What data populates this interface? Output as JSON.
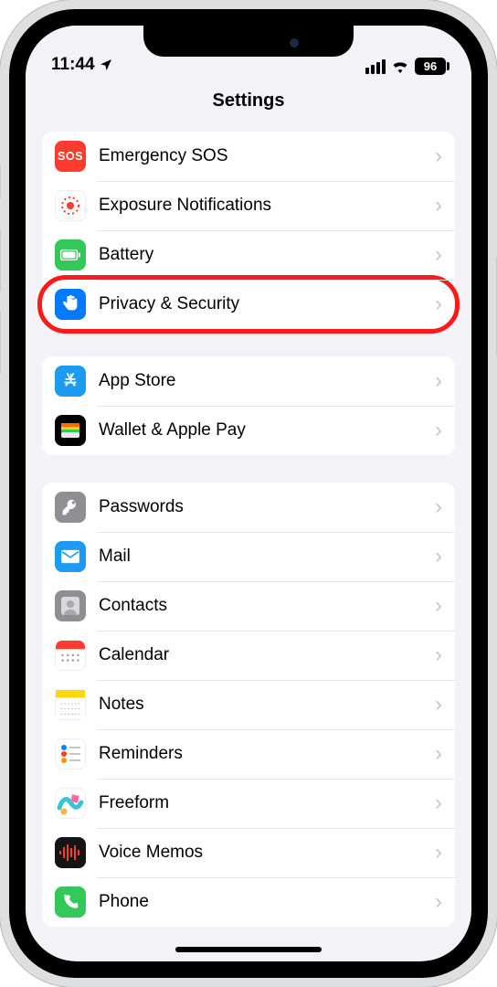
{
  "status": {
    "time": "11:44",
    "battery": "96"
  },
  "header": {
    "title": "Settings"
  },
  "groups": [
    {
      "rows": [
        {
          "id": "emergency-sos",
          "label": "Emergency SOS"
        },
        {
          "id": "exposure",
          "label": "Exposure Notifications"
        },
        {
          "id": "battery",
          "label": "Battery"
        },
        {
          "id": "privacy",
          "label": "Privacy & Security",
          "highlight": true
        }
      ]
    },
    {
      "rows": [
        {
          "id": "app-store",
          "label": "App Store"
        },
        {
          "id": "wallet",
          "label": "Wallet & Apple Pay"
        }
      ]
    },
    {
      "rows": [
        {
          "id": "passwords",
          "label": "Passwords"
        },
        {
          "id": "mail",
          "label": "Mail"
        },
        {
          "id": "contacts",
          "label": "Contacts"
        },
        {
          "id": "calendar",
          "label": "Calendar"
        },
        {
          "id": "notes",
          "label": "Notes"
        },
        {
          "id": "reminders",
          "label": "Reminders"
        },
        {
          "id": "freeform",
          "label": "Freeform"
        },
        {
          "id": "voicememos",
          "label": "Voice Memos"
        },
        {
          "id": "phone",
          "label": "Phone"
        }
      ]
    }
  ]
}
